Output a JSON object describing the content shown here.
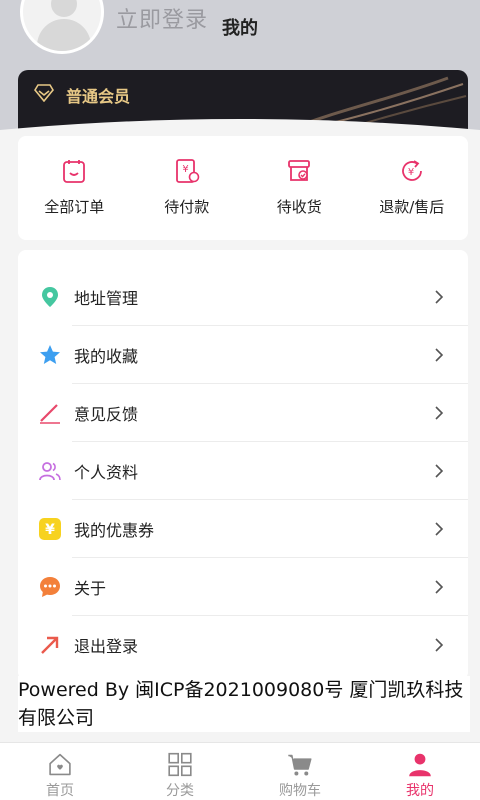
{
  "header": {
    "login_text": "立即登录",
    "title": "我的"
  },
  "member": {
    "label": "普通会员",
    "color": "#e7c886"
  },
  "orders": [
    {
      "label": "全部订单",
      "icon": "clipboard-icon"
    },
    {
      "label": "待付款",
      "icon": "yen-bill-icon"
    },
    {
      "label": "待收货",
      "icon": "box-check-icon"
    },
    {
      "label": "退款/售后",
      "icon": "yen-refresh-icon"
    }
  ],
  "menu": [
    {
      "label": "地址管理",
      "icon": "location-pin-icon"
    },
    {
      "label": "我的收藏",
      "icon": "star-icon"
    },
    {
      "label": "意见反馈",
      "icon": "pen-icon"
    },
    {
      "label": "个人资料",
      "icon": "users-icon"
    },
    {
      "label": "我的优惠券",
      "icon": "coupon-icon"
    },
    {
      "label": "关于",
      "icon": "chat-bubble-icon"
    },
    {
      "label": "退出登录",
      "icon": "arrow-exit-icon"
    }
  ],
  "footer": {
    "text": "Powered By 闽ICP备2021009080号 厦门凯玖科技有限公司"
  },
  "tabs": [
    {
      "label": "首页",
      "icon": "home-icon"
    },
    {
      "label": "分类",
      "icon": "grid-icon"
    },
    {
      "label": "购物车",
      "icon": "cart-icon"
    },
    {
      "label": "我的",
      "icon": "user-icon",
      "active": true
    }
  ],
  "colors": {
    "accent": "#e8336b",
    "gold": "#e7c886"
  }
}
